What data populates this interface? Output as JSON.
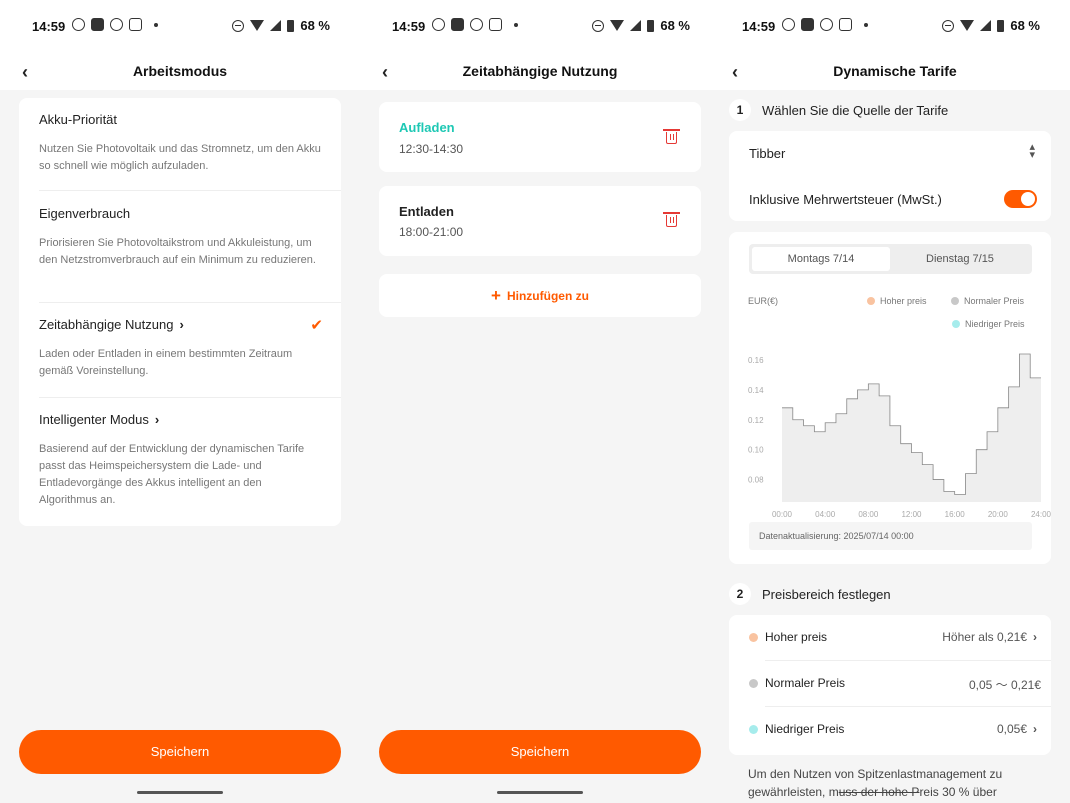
{
  "status": {
    "time": "14:59",
    "battery": "68 %"
  },
  "screen1": {
    "title": "Arbeitsmodus",
    "options": [
      {
        "title": "Akku-Priorität",
        "desc": "Nutzen Sie Photovoltaik und das Stromnetz, um den Akku so schnell wie möglich aufzuladen."
      },
      {
        "title": "Eigenverbrauch",
        "desc": "Priorisieren Sie Photovoltaikstrom und Akkuleistung, um den Netzstromverbrauch auf ein Minimum zu reduzieren."
      },
      {
        "title": "Zeitabhängige Nutzung",
        "desc": "Laden oder Entladen in einem bestimmten Zeitraum gemäß Voreinstellung.",
        "selected": true
      },
      {
        "title": "Intelligenter Modus",
        "desc": "Basierend auf der Entwicklung der dynamischen Tarife passt das Heimspeichersystem die Lade- und Entladevorgänge des Akkus intelligent an den Algorithmus an."
      }
    ],
    "save": "Speichern"
  },
  "screen2": {
    "title": "Zeitabhängige Nutzung",
    "schedules": [
      {
        "label": "Aufladen",
        "time": "12:30-14:30",
        "color": "#1ec8b4"
      },
      {
        "label": "Entladen",
        "time": "18:00-21:00",
        "color": "#222222"
      }
    ],
    "add": "Hinzufügen zu",
    "save": "Speichern"
  },
  "screen3": {
    "title": "Dynamische Tarife",
    "step1": {
      "num": "1",
      "label": "Wählen Sie die Quelle der Tarife"
    },
    "source": "Tibber",
    "vat_label": "Inklusive Mehrwertsteuer (MwSt.)",
    "vat_on": true,
    "tabs": [
      "Montags 7/14",
      "Dienstag 7/15"
    ],
    "update": "Datenaktualisierung: 2025/07/14 00:00",
    "step2": {
      "num": "2",
      "label": "Preisbereich festlegen"
    },
    "prices": [
      {
        "label": "Hoher preis",
        "value": "Höher als 0,21€",
        "color": "#f9c3a0",
        "chevron": true
      },
      {
        "label": "Normaler Preis",
        "value": "0,05 ～ 0,21€",
        "color": "#c8c8c8",
        "chevron": false
      },
      {
        "label": "Niedriger Preis",
        "value": "0,05€",
        "color": "#a6ecec",
        "chevron": true
      }
    ],
    "note_a": "Um den Nutzen von Spitzenlastmanagement zu gewährleisten, m",
    "note_b": "uss der hohe P",
    "note_c": "reis 30 % über"
  },
  "chart_data": {
    "type": "step-line",
    "ylabel": "EUR(€)",
    "legend": [
      {
        "name": "Hoher preis",
        "color": "#f9c3a0"
      },
      {
        "name": "Normaler Preis",
        "color": "#c8c8c8"
      },
      {
        "name": "Niedriger Preis",
        "color": "#a6ecec"
      }
    ],
    "legend_position": "top-right",
    "x_ticks": [
      "00:00",
      "04:00",
      "08:00",
      "12:00",
      "16:00",
      "20:00",
      "24:00"
    ],
    "y_ticks": [
      0.08,
      0.1,
      0.12,
      0.14,
      0.16
    ],
    "ylim": [
      0.065,
      0.17
    ],
    "xlim": [
      0,
      24
    ],
    "x": [
      0,
      1,
      2,
      3,
      4,
      5,
      6,
      7,
      8,
      9,
      10,
      11,
      12,
      13,
      14,
      15,
      16,
      17,
      18,
      19,
      20,
      21,
      22,
      23
    ],
    "values": [
      0.128,
      0.12,
      0.116,
      0.112,
      0.118,
      0.124,
      0.134,
      0.14,
      0.144,
      0.136,
      0.116,
      0.104,
      0.098,
      0.09,
      0.08,
      0.072,
      0.07,
      0.084,
      0.1,
      0.112,
      0.128,
      0.142,
      0.164,
      0.148
    ],
    "fill": "#eeeeee",
    "line": "#888888",
    "grid": false
  }
}
